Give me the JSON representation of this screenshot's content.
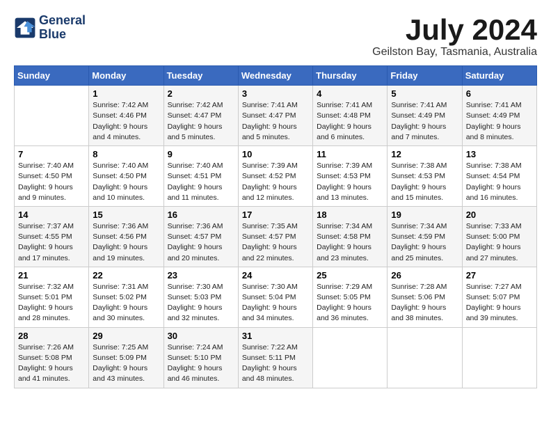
{
  "logo": {
    "line1": "General",
    "line2": "Blue"
  },
  "title": "July 2024",
  "location": "Geilston Bay, Tasmania, Australia",
  "weekdays": [
    "Sunday",
    "Monday",
    "Tuesday",
    "Wednesday",
    "Thursday",
    "Friday",
    "Saturday"
  ],
  "weeks": [
    [
      {
        "day": "",
        "sunrise": "",
        "sunset": "",
        "daylight": ""
      },
      {
        "day": "1",
        "sunrise": "7:42 AM",
        "sunset": "4:46 PM",
        "daylight": "9 hours and 4 minutes."
      },
      {
        "day": "2",
        "sunrise": "7:42 AM",
        "sunset": "4:47 PM",
        "daylight": "9 hours and 5 minutes."
      },
      {
        "day": "3",
        "sunrise": "7:41 AM",
        "sunset": "4:47 PM",
        "daylight": "9 hours and 5 minutes."
      },
      {
        "day": "4",
        "sunrise": "7:41 AM",
        "sunset": "4:48 PM",
        "daylight": "9 hours and 6 minutes."
      },
      {
        "day": "5",
        "sunrise": "7:41 AM",
        "sunset": "4:49 PM",
        "daylight": "9 hours and 7 minutes."
      },
      {
        "day": "6",
        "sunrise": "7:41 AM",
        "sunset": "4:49 PM",
        "daylight": "9 hours and 8 minutes."
      }
    ],
    [
      {
        "day": "7",
        "sunrise": "7:40 AM",
        "sunset": "4:50 PM",
        "daylight": "9 hours and 9 minutes."
      },
      {
        "day": "8",
        "sunrise": "7:40 AM",
        "sunset": "4:50 PM",
        "daylight": "9 hours and 10 minutes."
      },
      {
        "day": "9",
        "sunrise": "7:40 AM",
        "sunset": "4:51 PM",
        "daylight": "9 hours and 11 minutes."
      },
      {
        "day": "10",
        "sunrise": "7:39 AM",
        "sunset": "4:52 PM",
        "daylight": "9 hours and 12 minutes."
      },
      {
        "day": "11",
        "sunrise": "7:39 AM",
        "sunset": "4:53 PM",
        "daylight": "9 hours and 13 minutes."
      },
      {
        "day": "12",
        "sunrise": "7:38 AM",
        "sunset": "4:53 PM",
        "daylight": "9 hours and 15 minutes."
      },
      {
        "day": "13",
        "sunrise": "7:38 AM",
        "sunset": "4:54 PM",
        "daylight": "9 hours and 16 minutes."
      }
    ],
    [
      {
        "day": "14",
        "sunrise": "7:37 AM",
        "sunset": "4:55 PM",
        "daylight": "9 hours and 17 minutes."
      },
      {
        "day": "15",
        "sunrise": "7:36 AM",
        "sunset": "4:56 PM",
        "daylight": "9 hours and 19 minutes."
      },
      {
        "day": "16",
        "sunrise": "7:36 AM",
        "sunset": "4:57 PM",
        "daylight": "9 hours and 20 minutes."
      },
      {
        "day": "17",
        "sunrise": "7:35 AM",
        "sunset": "4:57 PM",
        "daylight": "9 hours and 22 minutes."
      },
      {
        "day": "18",
        "sunrise": "7:34 AM",
        "sunset": "4:58 PM",
        "daylight": "9 hours and 23 minutes."
      },
      {
        "day": "19",
        "sunrise": "7:34 AM",
        "sunset": "4:59 PM",
        "daylight": "9 hours and 25 minutes."
      },
      {
        "day": "20",
        "sunrise": "7:33 AM",
        "sunset": "5:00 PM",
        "daylight": "9 hours and 27 minutes."
      }
    ],
    [
      {
        "day": "21",
        "sunrise": "7:32 AM",
        "sunset": "5:01 PM",
        "daylight": "9 hours and 28 minutes."
      },
      {
        "day": "22",
        "sunrise": "7:31 AM",
        "sunset": "5:02 PM",
        "daylight": "9 hours and 30 minutes."
      },
      {
        "day": "23",
        "sunrise": "7:30 AM",
        "sunset": "5:03 PM",
        "daylight": "9 hours and 32 minutes."
      },
      {
        "day": "24",
        "sunrise": "7:30 AM",
        "sunset": "5:04 PM",
        "daylight": "9 hours and 34 minutes."
      },
      {
        "day": "25",
        "sunrise": "7:29 AM",
        "sunset": "5:05 PM",
        "daylight": "9 hours and 36 minutes."
      },
      {
        "day": "26",
        "sunrise": "7:28 AM",
        "sunset": "5:06 PM",
        "daylight": "9 hours and 38 minutes."
      },
      {
        "day": "27",
        "sunrise": "7:27 AM",
        "sunset": "5:07 PM",
        "daylight": "9 hours and 39 minutes."
      }
    ],
    [
      {
        "day": "28",
        "sunrise": "7:26 AM",
        "sunset": "5:08 PM",
        "daylight": "9 hours and 41 minutes."
      },
      {
        "day": "29",
        "sunrise": "7:25 AM",
        "sunset": "5:09 PM",
        "daylight": "9 hours and 43 minutes."
      },
      {
        "day": "30",
        "sunrise": "7:24 AM",
        "sunset": "5:10 PM",
        "daylight": "9 hours and 46 minutes."
      },
      {
        "day": "31",
        "sunrise": "7:22 AM",
        "sunset": "5:11 PM",
        "daylight": "9 hours and 48 minutes."
      },
      {
        "day": "",
        "sunrise": "",
        "sunset": "",
        "daylight": ""
      },
      {
        "day": "",
        "sunrise": "",
        "sunset": "",
        "daylight": ""
      },
      {
        "day": "",
        "sunrise": "",
        "sunset": "",
        "daylight": ""
      }
    ]
  ]
}
